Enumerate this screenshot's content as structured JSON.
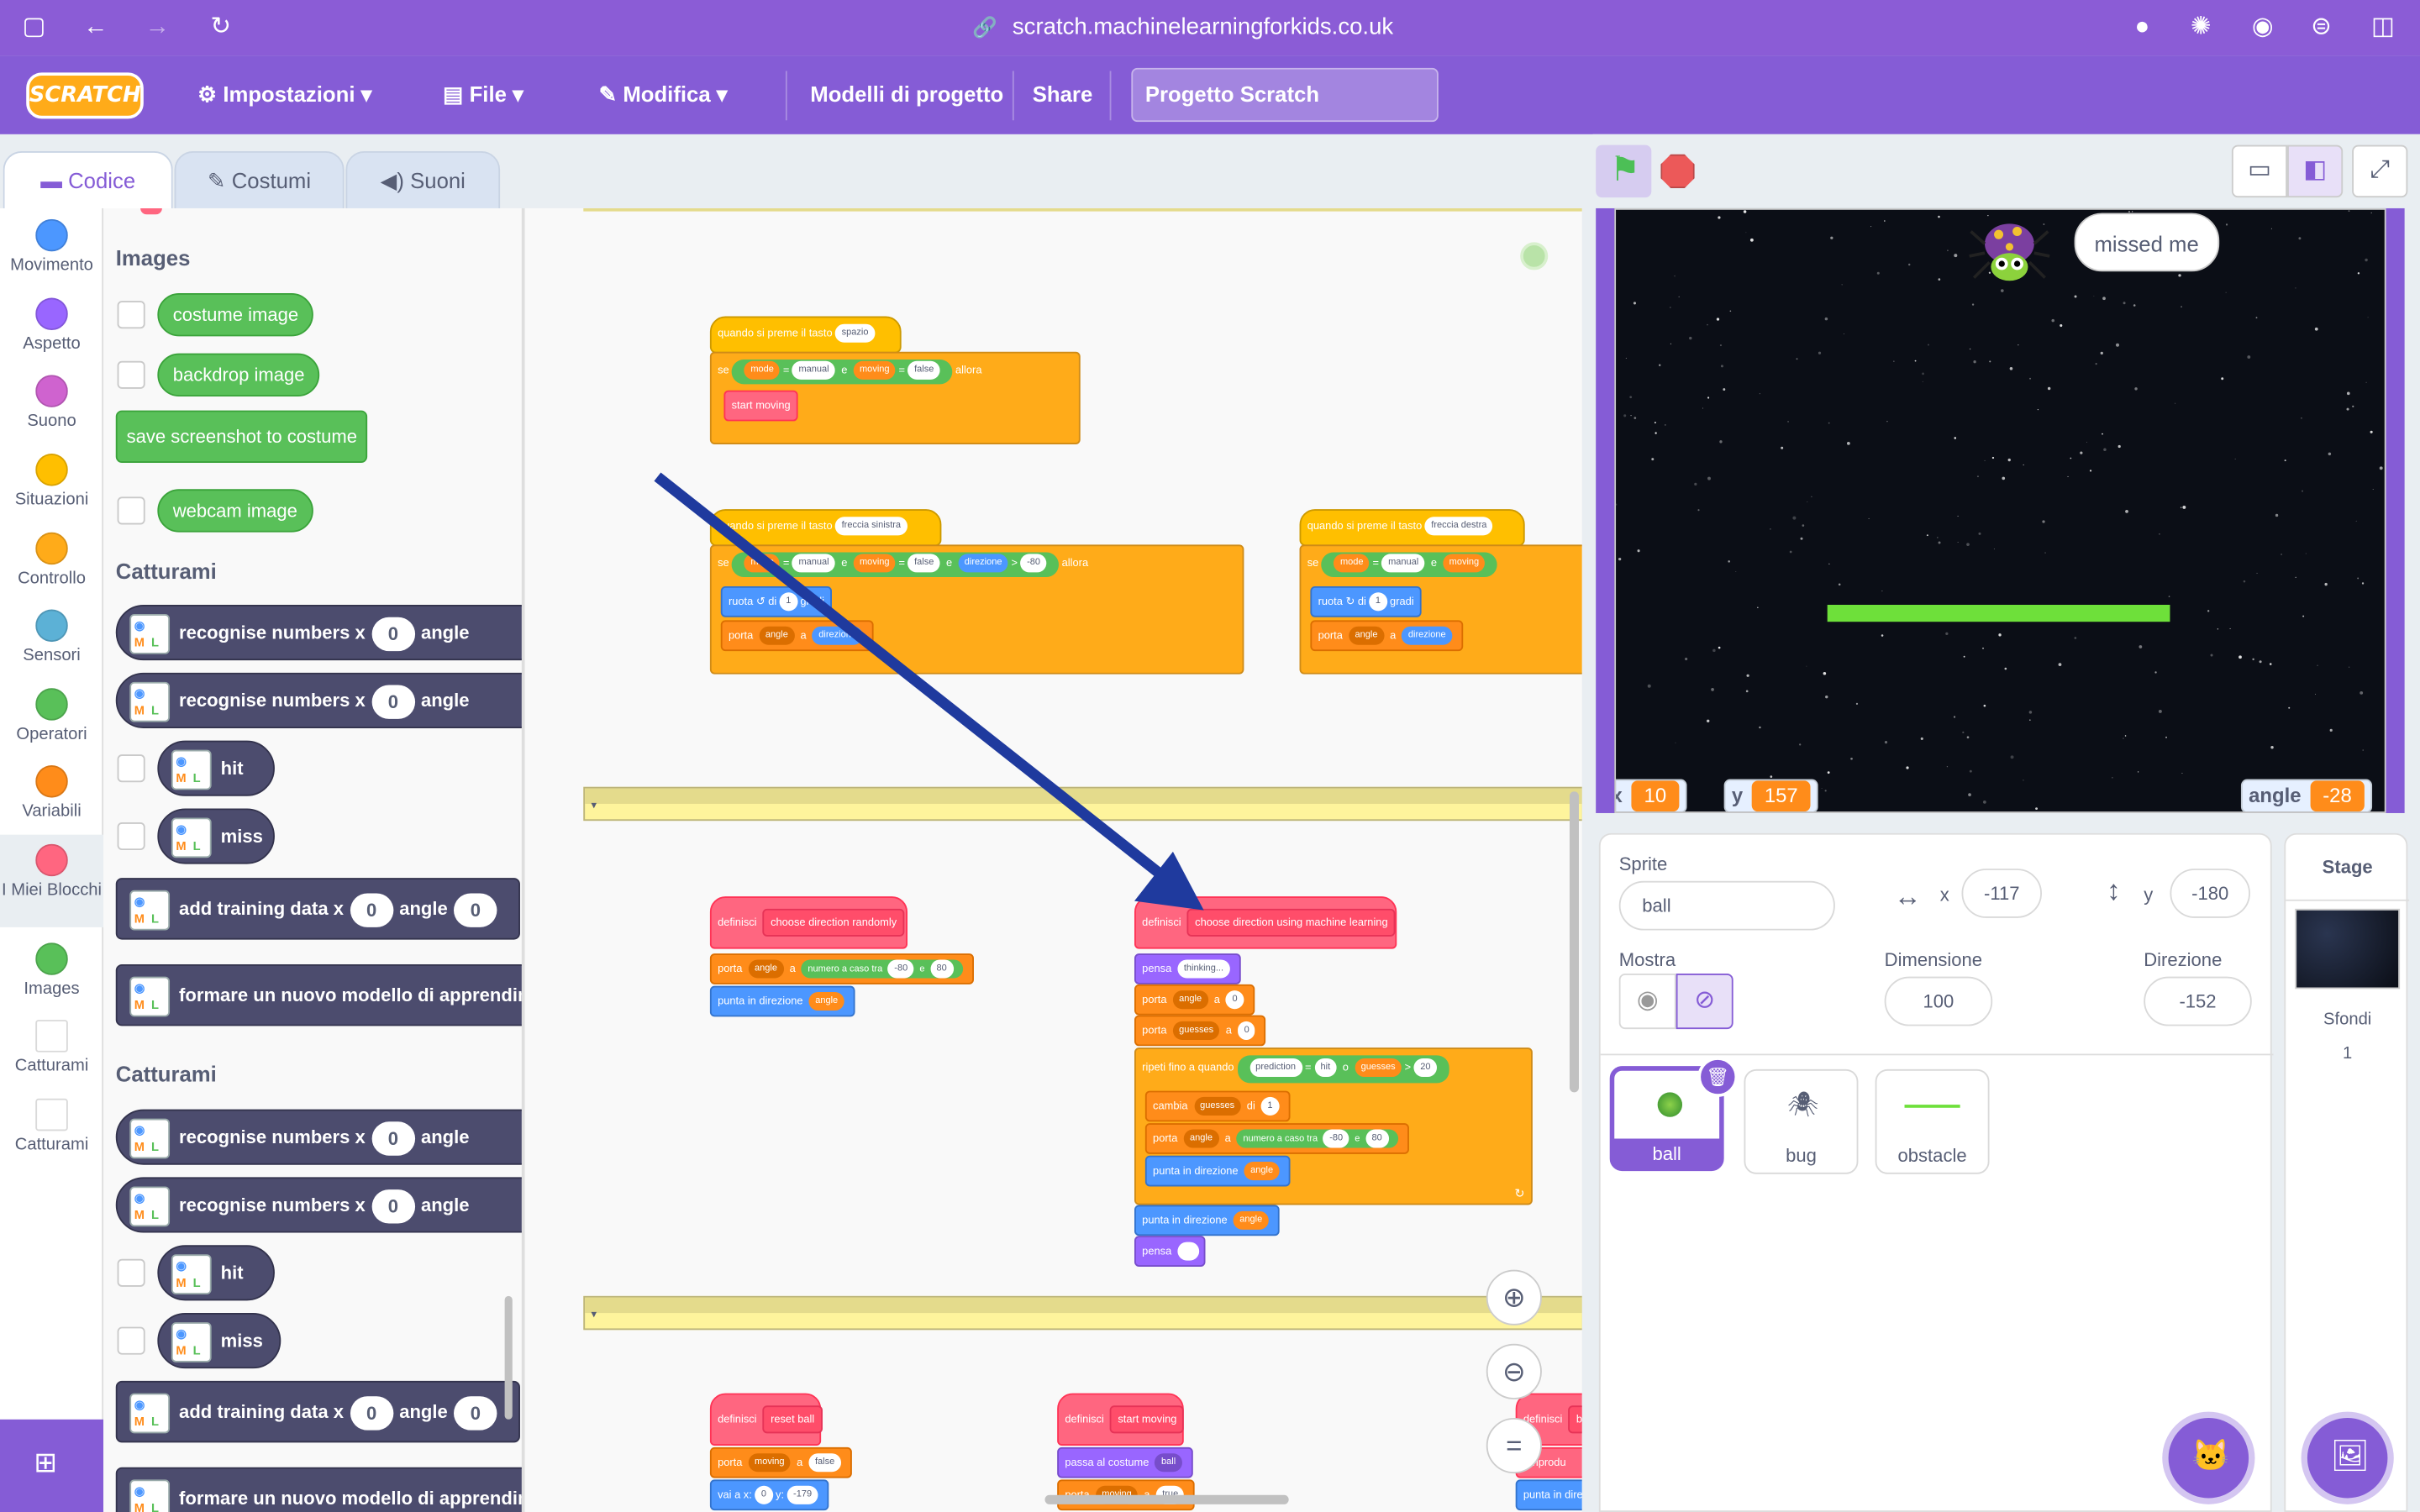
{
  "browser": {
    "url": "scratch.machinelearningforkids.co.uk"
  },
  "menubar": {
    "logo": "SCRATCH",
    "settings": "Impostazioni",
    "file": "File",
    "edit": "Modifica",
    "templates": "Modelli di progetto",
    "share": "Share",
    "project_title": "Progetto Scratch"
  },
  "tabs": {
    "code": "Codice",
    "costumes": "Costumi",
    "sounds": "Suoni"
  },
  "categories": [
    {
      "label": "Movimento",
      "color": "#4c97ff"
    },
    {
      "label": "Aspetto",
      "color": "#9966ff"
    },
    {
      "label": "Suono",
      "color": "#cf63cf"
    },
    {
      "label": "Situazioni",
      "color": "#ffbf00"
    },
    {
      "label": "Controllo",
      "color": "#ffab19"
    },
    {
      "label": "Sensori",
      "color": "#5cb1d6"
    },
    {
      "label": "Operatori",
      "color": "#59c059"
    },
    {
      "label": "Variabili",
      "color": "#ff8c1a"
    },
    {
      "label": "I Miei Blocchi",
      "color": "#ff6680"
    },
    {
      "label": "Images",
      "color": "#59c059"
    },
    {
      "label": "Catturami",
      "color": "#4c4c6e"
    },
    {
      "label": "Catturami",
      "color": "#4c4c6e"
    }
  ],
  "palette": {
    "images_title": "Images",
    "costume_image": "costume image",
    "backdrop_image": "backdrop image",
    "save_screenshot": "save screenshot to costume",
    "webcam_image": "webcam image",
    "catturami_title": "Catturami",
    "recognise_numbers": "recognise numbers",
    "x_label": "x",
    "angle_label": "angle",
    "zero": "0",
    "hit": "hit",
    "miss": "miss",
    "add_training_data": "add training data",
    "train_model": "formare un nuovo modello di apprendim"
  },
  "workspace": {
    "when_key": "quando si preme il tasto",
    "key_space": "spazio",
    "key_left": "freccia sinistra",
    "key_right": "freccia destra",
    "if": "se",
    "then": "allora",
    "and": "e",
    "equals": "=",
    "mode": "mode",
    "manual": "manual",
    "moving": "moving",
    "false": "false",
    "true": "true",
    "direction": "direzione",
    "minus80": "-80",
    "plus80": "80",
    "one": "1",
    "zero": "0",
    "twenty": "20",
    "minus179": "-179",
    "start_moving": "start moving",
    "turn": "ruota",
    "of": "di",
    "degrees": "gradi",
    "set": "porta",
    "to": "a",
    "angle": "angle",
    "define": "definisci",
    "choose_random": "choose direction randomly",
    "choose_ml": "choose direction using machine learning",
    "pick_random": "numero a caso tra",
    "point_dir": "punta in direzione",
    "think": "pensa",
    "thinking": "thinking...",
    "guesses": "guesses",
    "repeat_until": "ripeti fino a quando",
    "prediction": "prediction",
    "hit": "hit",
    "or": "o",
    "greater": ">",
    "change": "cambia",
    "reset_ball": "reset ball",
    "start_moving_def": "start moving",
    "switch_costume": "passa al costume",
    "ball": "ball",
    "go_to": "vai a x:",
    "y_label": "y:",
    "define_trunc": "definisci",
    "bo_trunc": "bo",
    "play_trunc": "a riprodu",
    "point_trunc": "punta in dire"
  },
  "stage": {
    "speech": "missed me",
    "monitor_x_label": "x",
    "monitor_x": "10",
    "monitor_y_label": "y",
    "monitor_y": "157",
    "monitor_angle_label": "angle",
    "monitor_angle": "-28"
  },
  "sprite_info": {
    "sprite_label": "Sprite",
    "sprite_name": "ball",
    "x_label": "x",
    "x_value": "-117",
    "y_label": "y",
    "y_value": "-180",
    "show_label": "Mostra",
    "size_label": "Dimensione",
    "size_value": "100",
    "direction_label": "Direzione",
    "direction_value": "-152"
  },
  "sprites": [
    {
      "name": "ball"
    },
    {
      "name": "bug"
    },
    {
      "name": "obstacle"
    }
  ],
  "stage_panel": {
    "title": "Stage",
    "backdrops_label": "Sfondi",
    "backdrops_count": "1"
  },
  "colors": {
    "brand": "#855cd6",
    "arrow": "#1f3a9e"
  }
}
